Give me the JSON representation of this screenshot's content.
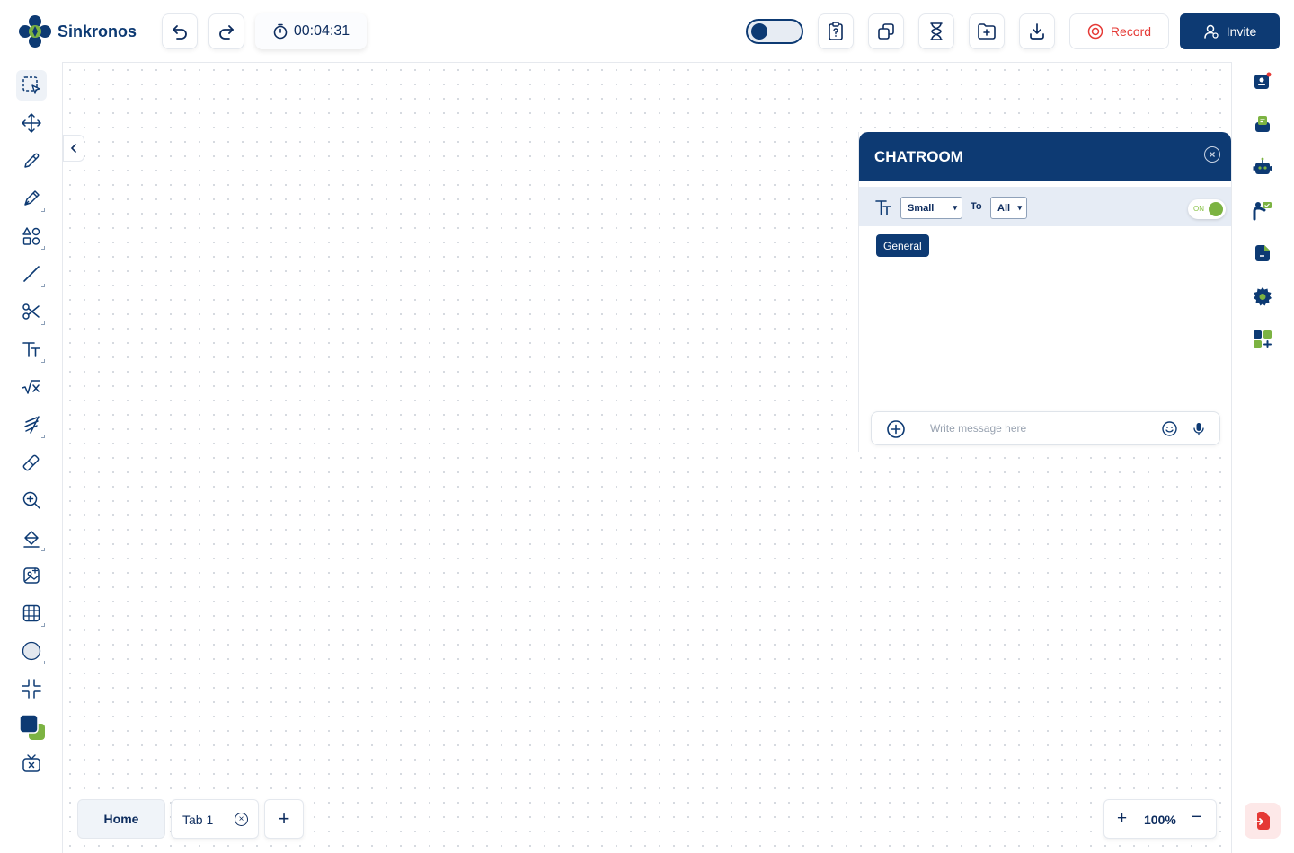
{
  "app": {
    "name": "Sinkronos"
  },
  "header": {
    "timer": "00:04:31",
    "record_label": "Record",
    "invite_label": "Invite",
    "theme_toggle": "dark"
  },
  "chatroom": {
    "title": "CHATROOM",
    "font_size_selected": "Small",
    "to_label": "To",
    "recipient_selected": "All",
    "toggle_label": "ON",
    "channel_tag": "General",
    "input_placeholder": "Write message here"
  },
  "tabs": {
    "home_label": "Home",
    "tab1_label": "Tab 1",
    "close_symbol": "×",
    "add_symbol": "+"
  },
  "zoom": {
    "plus": "+",
    "value": "100%",
    "minus": "−"
  },
  "colors": {
    "brand": "#0d3a73",
    "accent_green": "#7cb342",
    "record_red": "#e53935"
  }
}
